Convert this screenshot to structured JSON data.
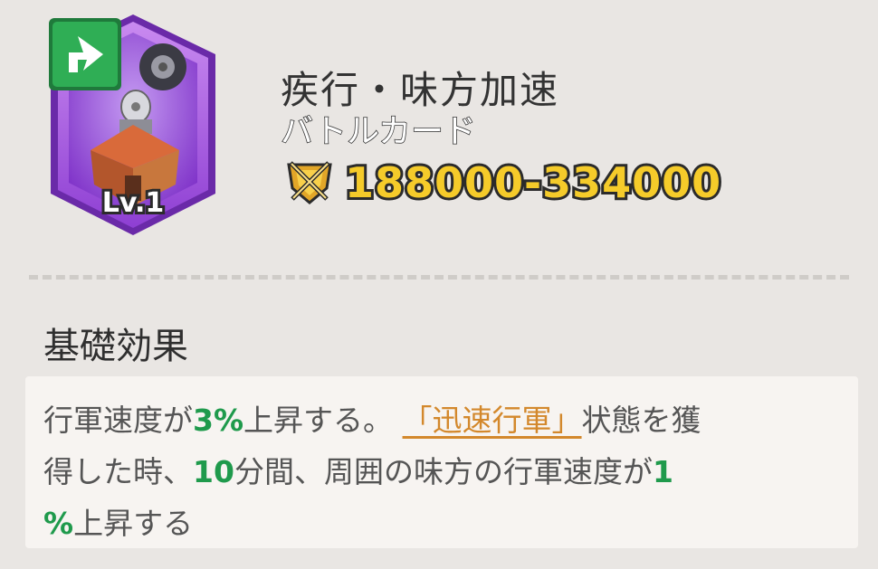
{
  "card": {
    "level": "Lv.1",
    "name": "疾行・味方加速",
    "type": "バトルカード",
    "power_range": "188000-334000"
  },
  "effect": {
    "section_title": "基礎効果",
    "line1": {
      "t1": "行軍速度が",
      "v1": "3%",
      "t2": "上昇する。",
      "status": "「迅速行軍」",
      "t3": "状態を獲"
    },
    "line2": {
      "t1": "得した時、",
      "v1": "10",
      "t2": "分間、周囲の味方の行軍速度が",
      "v2": "1"
    },
    "line3": {
      "v1": "%",
      "t1": "上昇する"
    }
  },
  "colors": {
    "frame": "#a65be0",
    "badge": "#2fae55",
    "power": "#f5cb2a",
    "highlight_green": "#1f9a4c",
    "highlight_orange": "#d3882c"
  },
  "icons": {
    "card_art": "buff-radar-building-icon",
    "badge": "green-arrow-badge-icon",
    "power": "crossed-swords-shield-icon"
  }
}
